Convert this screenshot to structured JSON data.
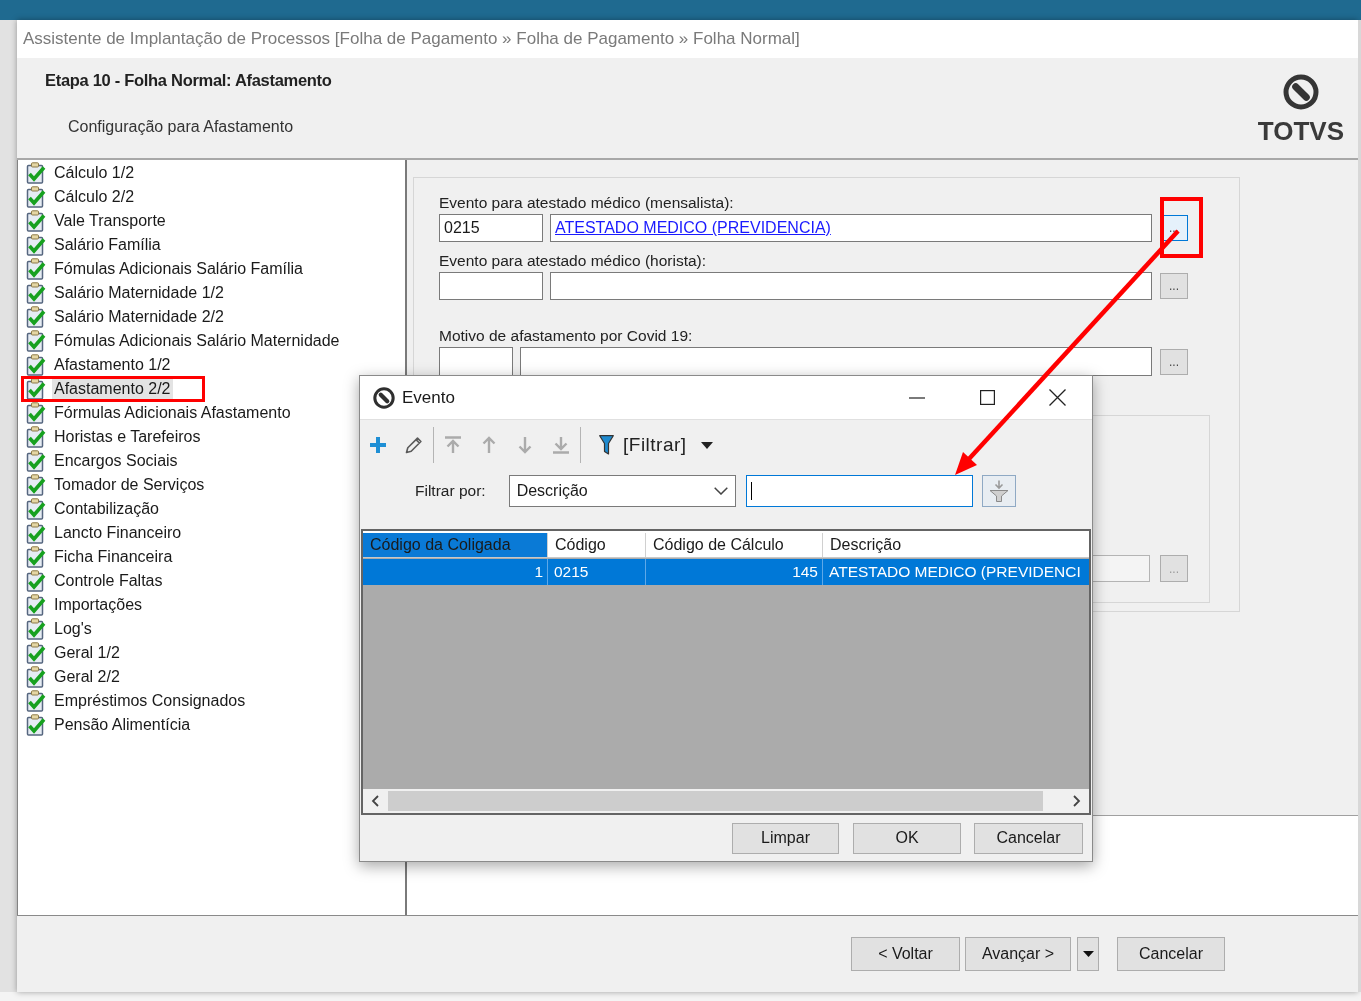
{
  "window": {
    "title": "Assistente de Implantação de Processos [Folha de Pagamento » Folha de Pagamento » Folha Normal]"
  },
  "header": {
    "title": "Etapa 10 - Folha Normal: Afastamento",
    "subtitle": "Configuração para Afastamento",
    "logo": "TOTVS"
  },
  "steps": [
    {
      "label": "Cálculo 1/2",
      "checked": true,
      "selected": false,
      "annotated": false
    },
    {
      "label": "Cálculo 2/2",
      "checked": true,
      "selected": false,
      "annotated": false
    },
    {
      "label": "Vale Transporte",
      "checked": true,
      "selected": false,
      "annotated": false
    },
    {
      "label": "Salário Família",
      "checked": true,
      "selected": false,
      "annotated": false
    },
    {
      "label": "Fómulas Adicionais Salário Família",
      "checked": true,
      "selected": false,
      "annotated": false
    },
    {
      "label": "Salário Maternidade 1/2",
      "checked": true,
      "selected": false,
      "annotated": false
    },
    {
      "label": "Salário Maternidade 2/2",
      "checked": true,
      "selected": false,
      "annotated": false
    },
    {
      "label": "Fómulas Adicionais Salário Maternidade",
      "checked": true,
      "selected": false,
      "annotated": false
    },
    {
      "label": "Afastamento 1/2",
      "checked": true,
      "selected": false,
      "annotated": false
    },
    {
      "label": "Afastamento 2/2",
      "checked": true,
      "selected": true,
      "annotated": true
    },
    {
      "label": "Fórmulas Adicionais Afastamento",
      "checked": true,
      "selected": false,
      "annotated": false
    },
    {
      "label": "Horistas e Tarefeiros",
      "checked": true,
      "selected": false,
      "annotated": false
    },
    {
      "label": "Encargos Sociais",
      "checked": true,
      "selected": false,
      "annotated": false
    },
    {
      "label": "Tomador de Serviços",
      "checked": true,
      "selected": false,
      "annotated": false
    },
    {
      "label": "Contabilização",
      "checked": true,
      "selected": false,
      "annotated": false
    },
    {
      "label": "Lancto Financeiro",
      "checked": true,
      "selected": false,
      "annotated": false
    },
    {
      "label": "Ficha Financeira",
      "checked": true,
      "selected": false,
      "annotated": false
    },
    {
      "label": "Controle Faltas",
      "checked": true,
      "selected": false,
      "annotated": false
    },
    {
      "label": "Importações",
      "checked": true,
      "selected": false,
      "annotated": false
    },
    {
      "label": "Log's",
      "checked": true,
      "selected": false,
      "annotated": false
    },
    {
      "label": "Geral 1/2",
      "checked": true,
      "selected": false,
      "annotated": false
    },
    {
      "label": "Geral 2/2",
      "checked": true,
      "selected": false,
      "annotated": false
    },
    {
      "label": "Empréstimos Consignados",
      "checked": true,
      "selected": false,
      "annotated": false
    },
    {
      "label": "Pensão Alimentícia",
      "checked": true,
      "selected": false,
      "annotated": false
    }
  ],
  "form": {
    "fields": [
      {
        "label": "Evento para atestado médico (mensalista):",
        "code": "0215",
        "description": "ATESTADO MEDICO (PREVIDENCIA)",
        "button": "...",
        "focused": true,
        "annotated": true
      },
      {
        "label": "Evento para atestado médico (horista):",
        "button": "...",
        "focused": false,
        "annotated": false
      },
      {
        "label": "Motivo de afastamento por Covid 19:",
        "button": "...",
        "focused": false,
        "annotated": false
      }
    ],
    "group": {
      "button": "..."
    }
  },
  "dialog": {
    "title": "Evento",
    "toolbar": [
      {
        "kind": "add",
        "disabled": false
      },
      {
        "kind": "edit",
        "disabled": false
      },
      {
        "kind": "first",
        "disabled": true
      },
      {
        "kind": "up",
        "disabled": true
      },
      {
        "kind": "down",
        "disabled": true
      },
      {
        "kind": "last",
        "disabled": true
      },
      {
        "kind": "filter",
        "label": "[Filtrar]",
        "disabled": false
      }
    ],
    "filter": {
      "label": "Filtrar por:",
      "field": "Descrição",
      "focused": true
    },
    "grid": {
      "columns": [
        {
          "label": "Código da Coligada",
          "kind": "number",
          "selected": true
        },
        {
          "label": "Código",
          "kind": "text",
          "selected": false
        },
        {
          "label": "Código de Cálculo",
          "kind": "number",
          "selected": false
        },
        {
          "label": "Descrição",
          "kind": "text",
          "selected": false
        }
      ],
      "rows": [
        {
          "cells": [
            "1",
            "0215",
            "145",
            "ATESTADO MEDICO (PREVIDENCI"
          ],
          "selected": true
        }
      ]
    },
    "buttons": [
      "Limpar",
      "OK",
      "Cancelar"
    ]
  },
  "footer": {
    "buttons": [
      {
        "label": "< Voltar",
        "menu": false
      },
      {
        "label": "Avançar >",
        "menu": true
      },
      {
        "label": "Cancelar",
        "menu": false
      }
    ]
  }
}
